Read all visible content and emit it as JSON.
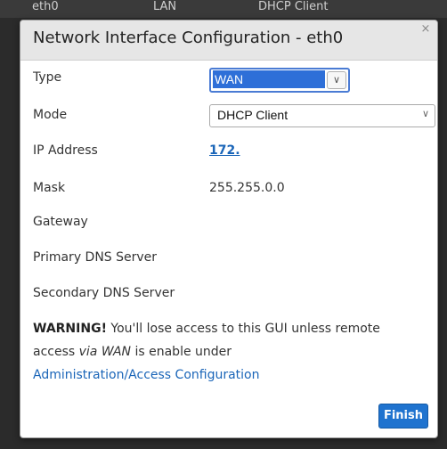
{
  "background": {
    "col_iface": "eth0",
    "col_type": "LAN",
    "col_mode": "DHCP Client"
  },
  "dialog": {
    "title": "Network Interface Configuration - eth0",
    "close_glyph": "×",
    "fields": {
      "type_label": "Type",
      "type_value": "WAN",
      "mode_label": "Mode",
      "mode_value": "DHCP Client",
      "ip_label": "IP Address",
      "ip_value": "172.",
      "mask_label": "Mask",
      "mask_value": "255.255.0.0",
      "gateway_label": "Gateway",
      "dns1_label": "Primary DNS Server",
      "dns2_label": "Secondary DNS Server"
    },
    "warning": {
      "strong": "WARNING!",
      "text1": " You'll lose access to this GUI unless remote access ",
      "emph": "via WAN",
      "text2": " is enable under ",
      "link": "Administration/Access Configuration"
    },
    "finish_label": "Finish"
  },
  "colors": {
    "accent": "#1f73cf",
    "selected": "#2e6fd8",
    "link": "#1a65b8"
  }
}
